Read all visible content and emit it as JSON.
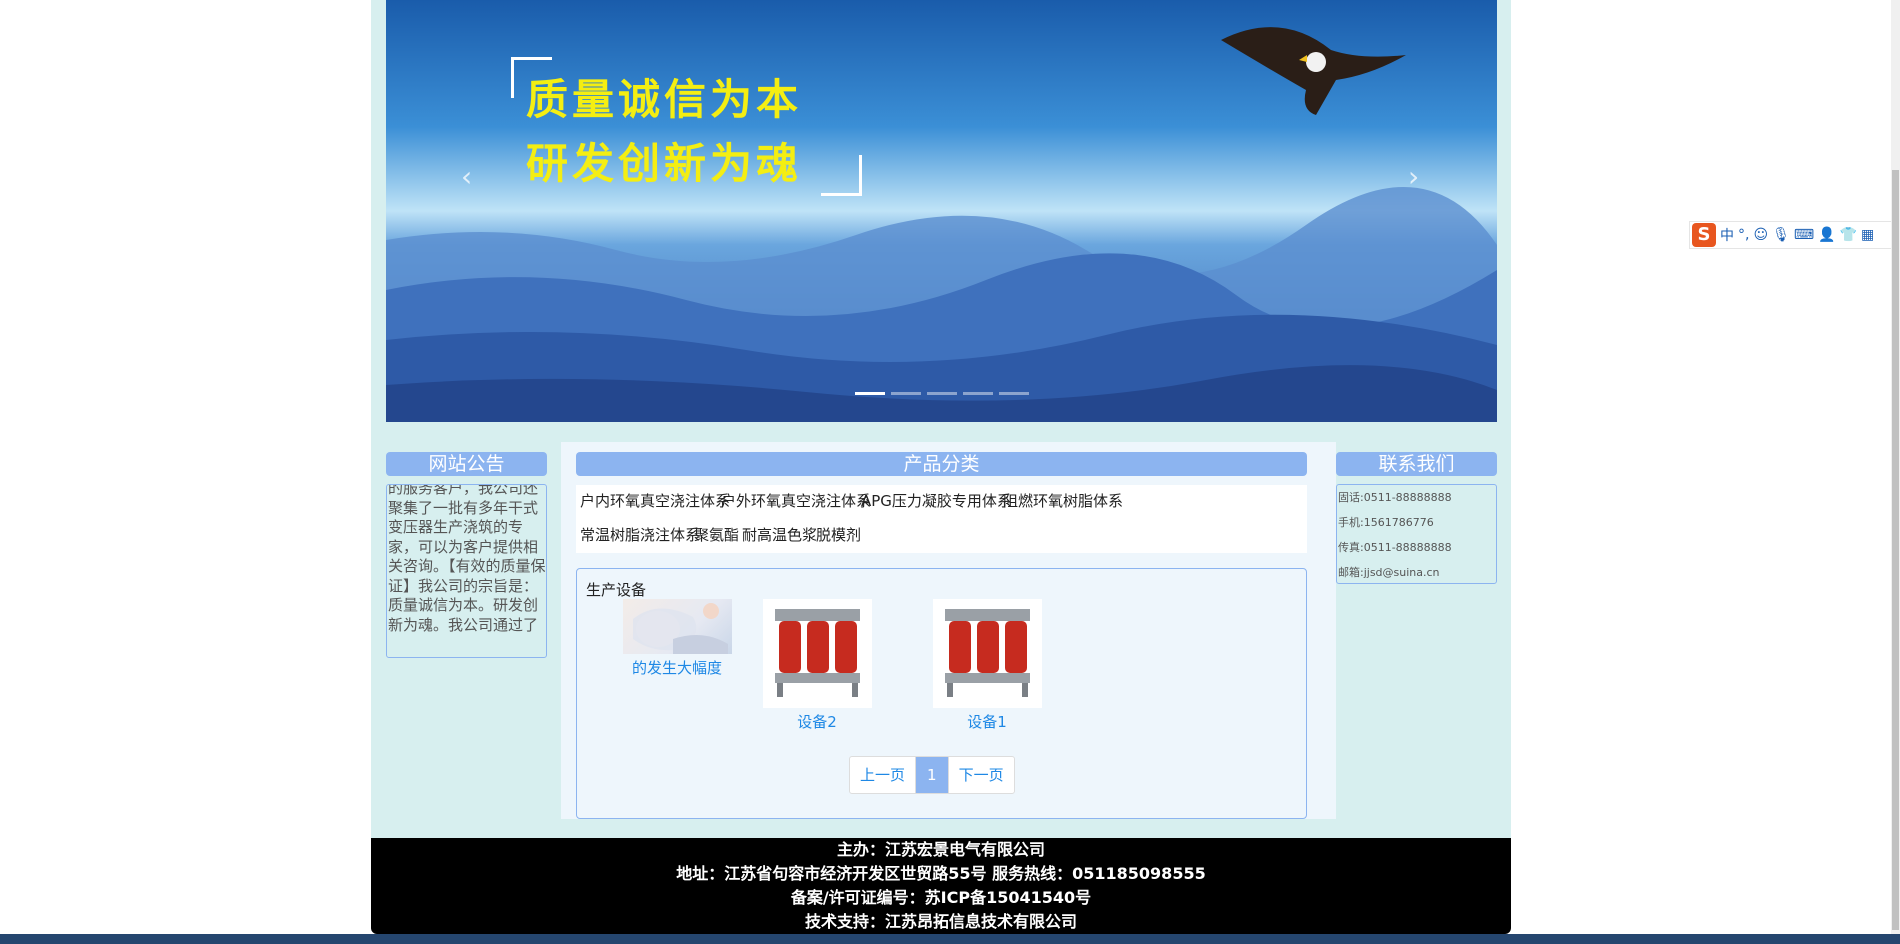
{
  "banner": {
    "slogan_line1": "质量诚信为本",
    "slogan_line2": "研发创新为魂",
    "prev_arrow": "‹",
    "next_arrow": "›",
    "slide_count": 5,
    "active_slide": 1
  },
  "notice": {
    "title": "网站公告",
    "text": "的服务客户，我公司还聚集了一批有多年干式变压器生产浇筑的专家，可以为客户提供相关咨询。【有效的质量保证】我公司的宗旨是：质量诚信为本。研发创新为魂。我公司通过了"
  },
  "categories": {
    "title": "产品分类",
    "items": [
      "户内环氧真空浇注体系",
      "户外环氧真空浇注体系",
      "APG压力凝胶专用体系",
      "阻燃环氧树脂体系",
      "常温树脂浇注体系",
      "聚氨酯",
      "耐高温色浆",
      "脱模剂"
    ]
  },
  "equipment": {
    "title": "生产设备",
    "products": [
      {
        "label": "的发生大幅度",
        "icon": "anime-picture-thumbnail"
      },
      {
        "label": "设备2",
        "icon": "transformer-thumbnail"
      },
      {
        "label": "设备1",
        "icon": "transformer-thumbnail"
      }
    ],
    "pager": {
      "prev": "上一页",
      "current": "1",
      "next": "下一页"
    }
  },
  "contact": {
    "title": "联系我们",
    "phone": "固话:0511-88888888",
    "mobile": "手机:1561786776",
    "fax": "传真:0511-88888888",
    "email": "邮箱:jjsd@suina.cn"
  },
  "footer": {
    "line1": "主办：江苏宏景电气有限公司",
    "line2": "地址：江苏省句容市经济开发区世贸路55号 服务热线：051185098555",
    "line3": "备案/许可证编号：苏ICP备15041540号",
    "line4": "技术支持：江苏昂拓信息技术有限公司"
  },
  "ime": {
    "logo": "S",
    "mode": "中",
    "punct": "°,",
    "icons": [
      "emoji-icon",
      "microphone-icon",
      "keyboard-icon",
      "user-icon",
      "shirt-icon",
      "grid-icon"
    ]
  },
  "colors": {
    "accent": "#8cb4f0",
    "page_bg": "#d7efef",
    "link": "#1e88e5",
    "slogan": "#f4ee12"
  }
}
